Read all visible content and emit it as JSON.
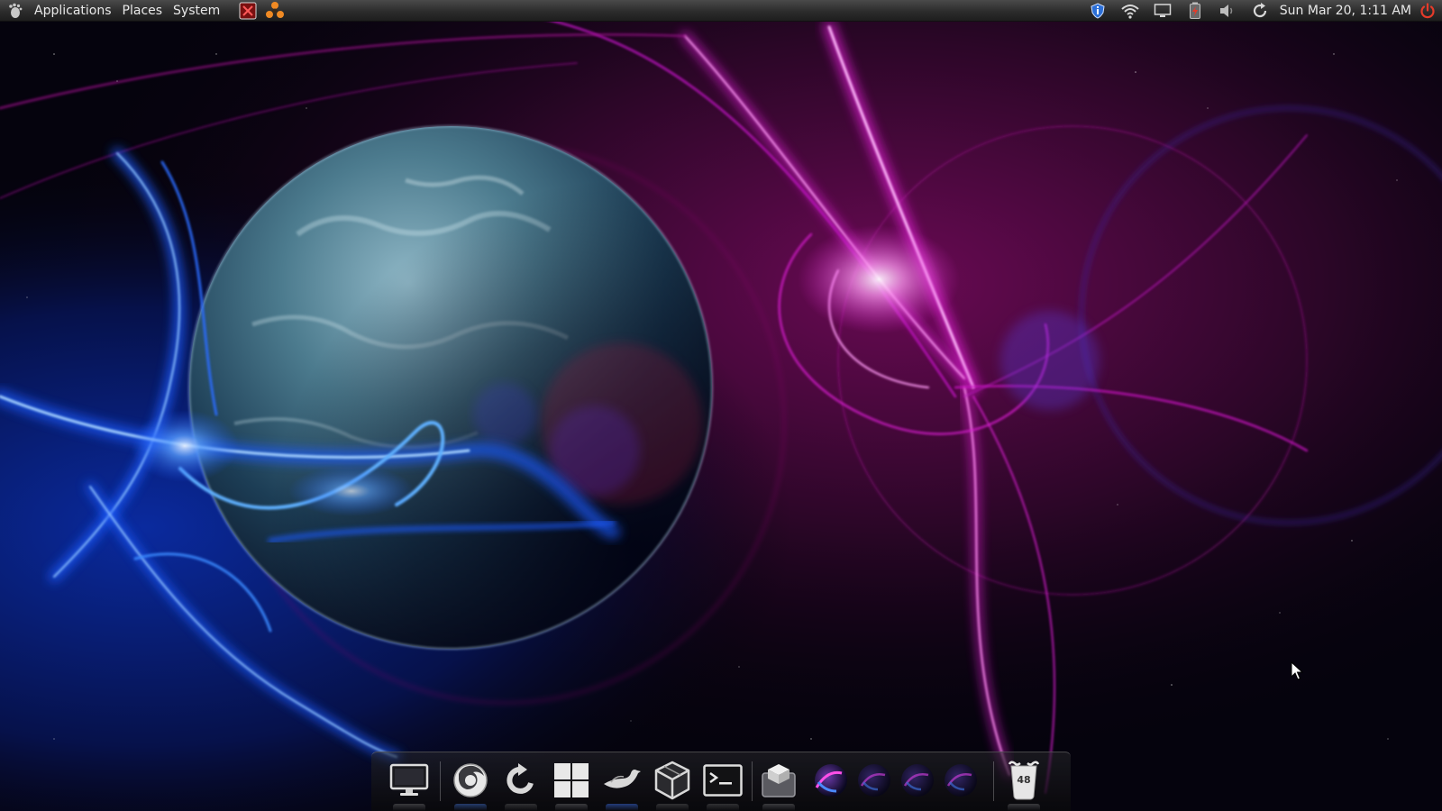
{
  "top_panel": {
    "menus": {
      "applications": "Applications",
      "places": "Places",
      "system": "System"
    },
    "launchers": [
      "terminal-red-icon",
      "ubuntu-tweak-icon"
    ],
    "tray_icons": [
      "shield-update-icon",
      "wifi-icon",
      "display-icon",
      "battery-icon",
      "volume-icon",
      "refresh-icon"
    ],
    "clock": "Sun Mar 20,  1:11 AM",
    "power_icon": "power-icon",
    "colors": {
      "panel": "#2c2c2c",
      "text": "#e8e8e8",
      "power": "#e53b2a"
    }
  },
  "dock": {
    "items": [
      "show-desktop-icon",
      "firefox-icon",
      "update-arrow-icon",
      "windows-icon",
      "bird-icon",
      "package-cube-icon",
      "terminal-icon",
      "box-icon",
      "workspace-1-icon",
      "workspace-2-icon",
      "workspace-3-icon",
      "workspace-4-icon",
      "trash-icon"
    ],
    "trash_count": "48"
  },
  "wallpaper": {
    "colors": {
      "space": "#05030d",
      "magenta": "#e11fd6",
      "blue": "#1d5cff",
      "planet": "#3f6a7d"
    }
  }
}
